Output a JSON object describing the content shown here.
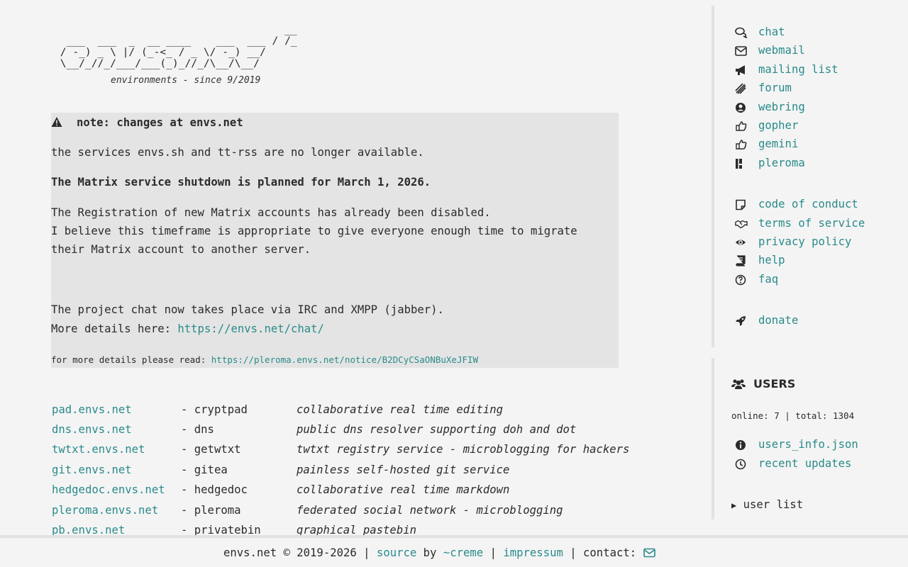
{
  "logo": {
    "ascii": "                                     __\n  ___  ___  _  __ ____    ___  ___ / /_\n / -_) _ \\ |/ (_-<_ / _ \\/ -_) __/\n \\__/_//_/___/___(_)_//_/\\__/\\__/",
    "tagline": "environments - since 9/2019"
  },
  "note": {
    "title": "note: changes at envs.net",
    "line1": "the services envs.sh and tt-rss are no longer available.",
    "line2": "The Matrix service shutdown is planned for March 1, 2026.",
    "para1": "The Registration of new Matrix accounts has already been disabled.",
    "para2": "I believe this timeframe is appropriate to give everyone enough time to migrate",
    "para3": "their Matrix account to another server.",
    "chat1": "The project chat now takes place via IRC and XMPP (jabber).",
    "chat2_prefix": "More details here: ",
    "chat2_link": "https://envs.net/chat/",
    "more_prefix": "for more details please read: ",
    "more_link": "https://pleroma.envs.net/notice/B2DCyCSaONBuXeJFIW"
  },
  "services": [
    {
      "host": "pad.envs.net",
      "name": "- cryptpad",
      "desc": "collaborative real time editing"
    },
    {
      "host": "dns.envs.net",
      "name": "- dns",
      "desc": "public dns resolver supporting doh and dot"
    },
    {
      "host": "twtxt.envs.net",
      "name": "- getwtxt",
      "desc": "twtxt registry service - microblogging for hackers"
    },
    {
      "host": "git.envs.net",
      "name": "- gitea",
      "desc": "painless self-hosted git service"
    },
    {
      "host": "hedgedoc.envs.net",
      "name": "- hedgedoc",
      "desc": "collaborative real time markdown"
    },
    {
      "host": "pleroma.envs.net",
      "name": "- pleroma",
      "desc": "federated social network - microblogging"
    },
    {
      "host": "pb.envs.net",
      "name": "- privatebin",
      "desc": "graphical pastebin"
    }
  ],
  "nav_top": [
    {
      "label": "chat",
      "icon": "comments-icon"
    },
    {
      "label": "webmail",
      "icon": "envelope-icon"
    },
    {
      "label": "mailing list",
      "icon": "bullhorn-icon"
    },
    {
      "label": "forum",
      "icon": "discourse-icon"
    },
    {
      "label": "webring",
      "icon": "user-circle-icon"
    },
    {
      "label": "gopher",
      "icon": "hand-point-icon"
    },
    {
      "label": "gemini",
      "icon": "hand-point-icon"
    },
    {
      "label": "pleroma",
      "icon": "pleroma-icon"
    }
  ],
  "nav_mid": [
    {
      "label": "code of conduct",
      "icon": "sticky-note-icon"
    },
    {
      "label": "terms of service",
      "icon": "handshake-icon"
    },
    {
      "label": "privacy policy",
      "icon": "eye-icon"
    },
    {
      "label": "help",
      "icon": "book-icon"
    },
    {
      "label": "faq",
      "icon": "question-circle-icon"
    }
  ],
  "nav_bottom": [
    {
      "label": "donate",
      "icon": "rocket-icon"
    }
  ],
  "users": {
    "title": "USERS",
    "online_text": "online: 7 | total: 1304",
    "links": [
      {
        "label": "users_info.json",
        "icon": "info-circle-icon"
      },
      {
        "label": "recent updates",
        "icon": "clock-icon"
      }
    ],
    "toggle_label": "user list"
  },
  "footer": {
    "prefix": "envs.net © 2019-2026 | ",
    "source": "source",
    "by": " by ",
    "author": "~creme",
    "sep": " | ",
    "impressum": "impressum",
    "contact": " | contact: "
  },
  "colors": {
    "link": "#2a8a8a",
    "background": "#f4f4f4",
    "note_background": "#e4e4e4",
    "text": "#2b2b2b"
  }
}
